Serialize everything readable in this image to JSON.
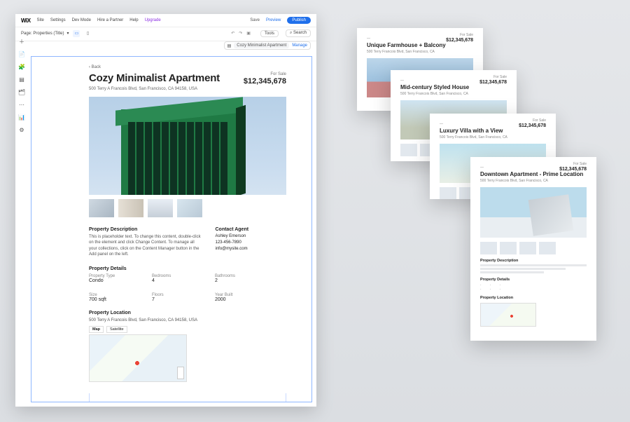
{
  "menu": {
    "items": [
      "Site",
      "Settings",
      "Dev Mode",
      "Hire a Partner",
      "Help"
    ],
    "upgrade": "Upgrade",
    "save": "Save",
    "preview": "Preview",
    "publish": "Publish"
  },
  "subbar": {
    "page_label": "Page: Properties (Title)",
    "inspector_label": "Cozy Minimalist Apartment",
    "inspector_action": "Manage",
    "tools_btn": "Tools",
    "search_btn": "Search"
  },
  "rail": [
    "＋",
    "📄",
    "🧩",
    "▤",
    "🗂",
    "⋯",
    "📊",
    "⚙"
  ],
  "listing": {
    "back": "‹ Back",
    "title": "Cozy Minimalist Apartment",
    "status": "For Sale",
    "price": "$12,345,678",
    "address": "500 Terry A Francois Blvd, San Francisco, CA 94158, USA",
    "desc_heading": "Property Description",
    "desc_body": "This is placeholder text. To change this content, double-click on the element and click Change Content. To manage all your collections, click on the Content Manager button in the Add panel on the left.",
    "agent_heading": "Contact Agent",
    "agent_name": "Ashley Emerson",
    "agent_phone": "123-456-7890",
    "agent_email": "info@mysite.com",
    "details_heading": "Property Details",
    "details": [
      {
        "label": "Property Type",
        "value": "Condo"
      },
      {
        "label": "Bedrooms",
        "value": "4"
      },
      {
        "label": "Bathrooms",
        "value": "2"
      },
      {
        "label": "Size",
        "value": "700 sqft"
      },
      {
        "label": "Floors",
        "value": "7"
      },
      {
        "label": "Year Built",
        "value": "2000"
      }
    ],
    "location_heading": "Property Location",
    "location_addr": "500 Terry A Francois Blvd, San Francisco, CA 94158, USA",
    "map_tabs": [
      "Map",
      "Satellite"
    ]
  },
  "repeater": [
    {
      "tag": "For Sale",
      "title": "Unique Farmhouse + Balcony",
      "sub": "500 Terry Francois Blvd, San Francisco, CA",
      "price": "$12,345,678"
    },
    {
      "tag": "For Sale",
      "title": "Mid-century Styled House",
      "sub": "500 Terry Francois Blvd, San Francisco, CA",
      "price": "$12,345,678"
    },
    {
      "tag": "For Sale",
      "title": "Luxury Villa with a View",
      "sub": "500 Terry Francois Blvd, San Francisco, CA",
      "price": "$12,345,678"
    },
    {
      "tag": "For Sale",
      "title": "Downtown Apartment - Prime Location",
      "sub": "500 Terry Francois Blvd, San Francisco, CA",
      "price": "$12,345,678",
      "desc_heading": "Property Description",
      "details_heading": "Property Details",
      "location_heading": "Property Location"
    }
  ]
}
